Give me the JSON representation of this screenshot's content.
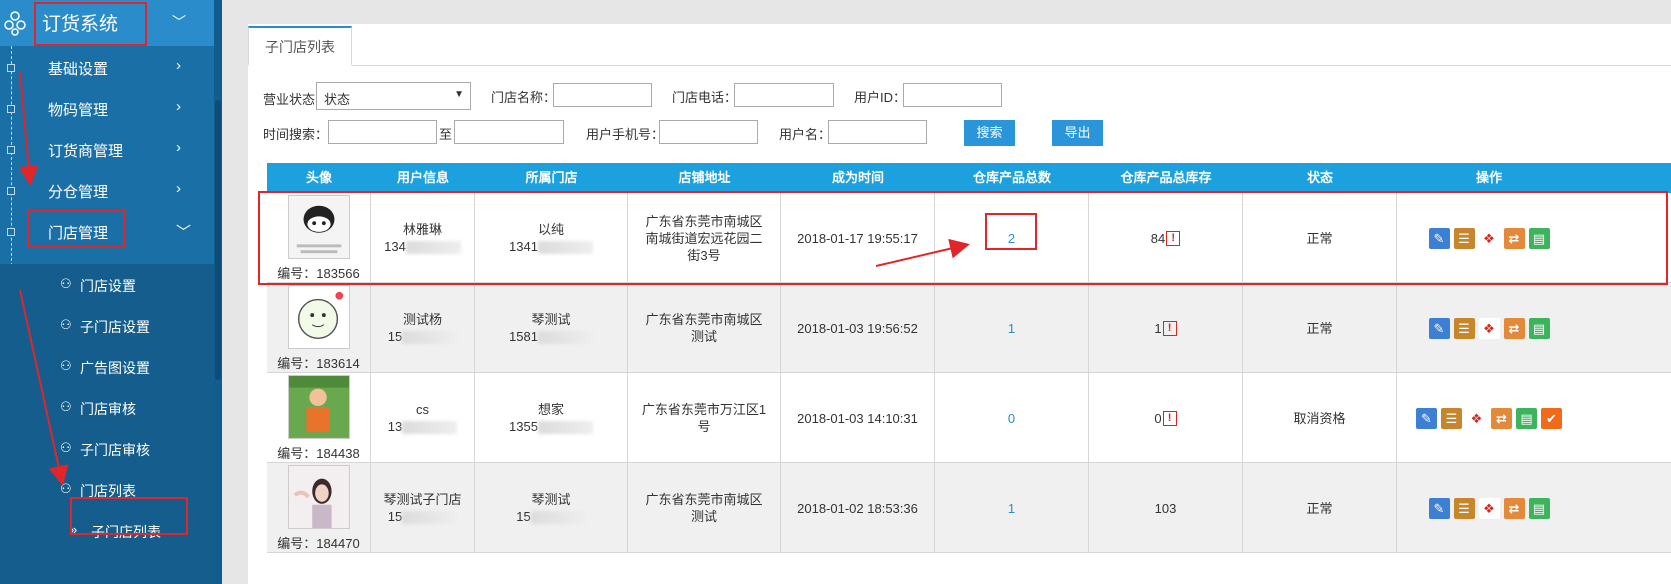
{
  "sidebar": {
    "title": "订货系统",
    "items": [
      {
        "label": "基础设置"
      },
      {
        "label": "物码管理"
      },
      {
        "label": "订货商管理"
      },
      {
        "label": "分仓管理"
      },
      {
        "label": "门店管理"
      }
    ],
    "sub_items": [
      {
        "label": "门店设置"
      },
      {
        "label": "子门店设置"
      },
      {
        "label": "广告图设置"
      },
      {
        "label": "门店审核"
      },
      {
        "label": "子门店审核"
      },
      {
        "label": "门店列表"
      },
      {
        "label": "子门店列表"
      }
    ]
  },
  "tab": {
    "label": "子门店列表"
  },
  "filters": {
    "status_label": "营业状态",
    "status_value": "状态",
    "store_name_label": "门店名称：",
    "store_phone_label": "门店电话：",
    "user_id_label": "用户ID：",
    "time_label": "时间搜索：",
    "time_to": "至",
    "user_phone_label": "用户手机号：",
    "username_label": "用户名：",
    "search_button": "搜索",
    "export_button": "导出"
  },
  "table": {
    "headers": [
      "头像",
      "用户信息",
      "所属门店",
      "店铺地址",
      "成为时间",
      "仓库产品总数",
      "仓库产品总库存",
      "状态",
      "操作"
    ],
    "rows": [
      {
        "id_label": "编号：183566",
        "user_name": "林雅琳",
        "user_phone": "134",
        "store_name": "以纯",
        "store_phone": "1341",
        "address": "广东省东莞市南城区南城街道宏远花园二街3号",
        "time": "2018-01-17 19:55:17",
        "product_count": "2",
        "stock": "84",
        "status": "正常"
      },
      {
        "id_label": "编号：183614",
        "user_name": "测试杨",
        "user_phone": "15",
        "store_name": "琴测试",
        "store_phone": "1581",
        "address": "广东省东莞市南城区测试",
        "time": "2018-01-03 19:56:52",
        "product_count": "1",
        "stock": "1",
        "status": "正常"
      },
      {
        "id_label": "编号：184438",
        "user_name": "cs",
        "user_phone": "13",
        "store_name": "想家",
        "store_phone": "1355",
        "address": "广东省东莞市万江区1号",
        "time": "2018-01-03 14:10:31",
        "product_count": "0",
        "stock": "0",
        "status": "取消资格"
      },
      {
        "id_label": "编号：184470",
        "user_name": "琴测试子门店",
        "user_phone": "15",
        "store_name": "琴测试",
        "store_phone": "15",
        "address": "广东省东莞市南城区测试",
        "time": "2018-01-02 18:53:36",
        "product_count": "1",
        "stock": "103",
        "status": "正常"
      }
    ]
  },
  "colors": {
    "sidebar_bg": "#1b6fa7",
    "header_bg": "#2a8ccb",
    "table_header_bg": "#1ca0de",
    "annotation_red": "#e0262b"
  },
  "icons": [
    "edit-icon",
    "list-icon",
    "boxes-icon",
    "transfer-icon",
    "report-icon",
    "check-icon"
  ]
}
